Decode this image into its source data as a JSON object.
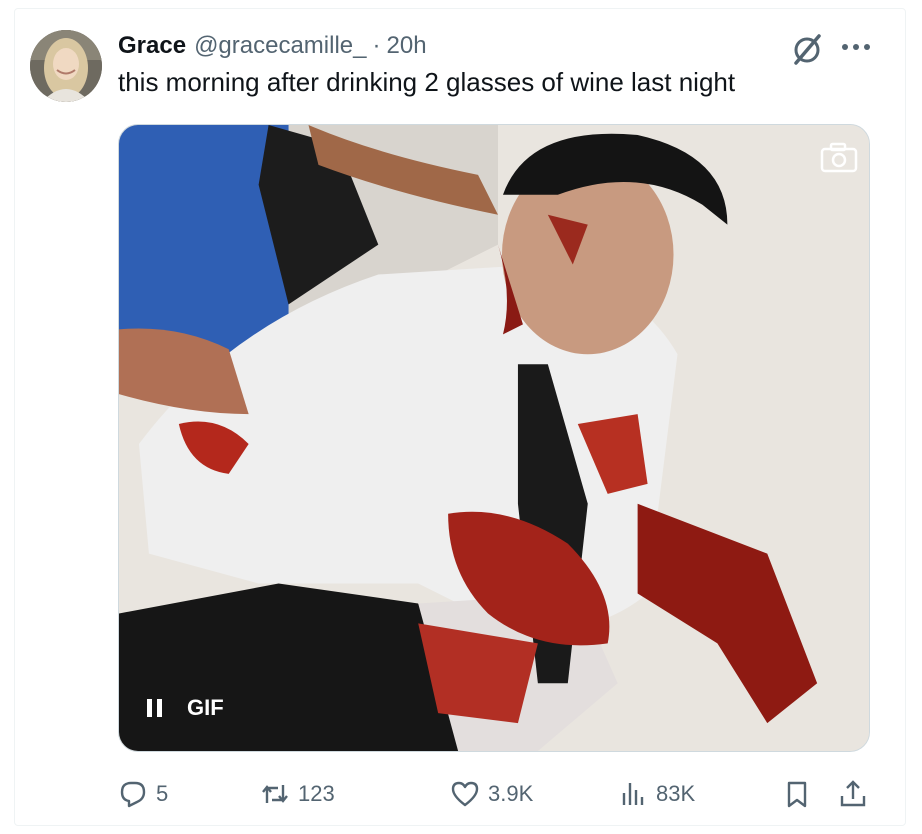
{
  "tweet": {
    "author_name": "Grace",
    "handle": "@gracecamille_",
    "separator": "·",
    "time": "20h",
    "text": "this morning after drinking 2 glasses of wine last night"
  },
  "media": {
    "type_label": "GIF",
    "playback_icon": "pause-icon",
    "corner_icon": "camera-icon"
  },
  "actions": {
    "replies": "5",
    "retweets": "123",
    "likes": "3.9K",
    "views": "83K"
  },
  "colors": {
    "text_primary": "#0f1419",
    "text_secondary": "#536471",
    "border": "#cfd9de"
  }
}
